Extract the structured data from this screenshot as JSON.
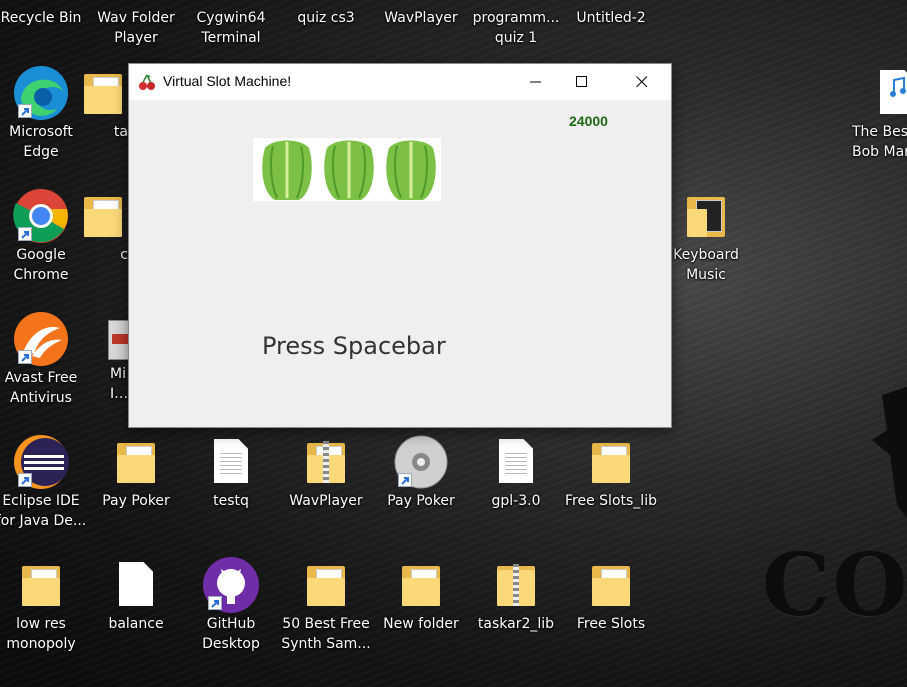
{
  "desktop": {
    "brand_text": "COI",
    "icons": [
      {
        "id": "recycle",
        "label": "Recycle Bin"
      },
      {
        "id": "wavfolder",
        "label": "Wav Folder Player"
      },
      {
        "id": "cygwin",
        "label": "Cygwin64 Terminal"
      },
      {
        "id": "quizcs3",
        "label": "quiz cs3"
      },
      {
        "id": "wavplayer-top",
        "label": "WavPlayer"
      },
      {
        "id": "programm",
        "label": "programm... quiz 1"
      },
      {
        "id": "untitled2",
        "label": "Untitled-2"
      },
      {
        "id": "edge",
        "label": "Microsoft Edge"
      },
      {
        "id": "ta",
        "label": "ta"
      },
      {
        "id": "chrome",
        "label": "Google Chrome"
      },
      {
        "id": "c",
        "label": "c"
      },
      {
        "id": "avast",
        "label": "Avast Free Antivirus"
      },
      {
        "id": "mi",
        "label": "Mi Ins"
      },
      {
        "id": "bestbob",
        "label": "The Best Bob Mar"
      },
      {
        "id": "keyboard",
        "label": "Keyboard Music"
      },
      {
        "id": "eclipse",
        "label": "Eclipse IDE for Java De..."
      },
      {
        "id": "paypoker1",
        "label": "Pay Poker"
      },
      {
        "id": "testq",
        "label": "testq"
      },
      {
        "id": "wavplayer",
        "label": "WavPlayer"
      },
      {
        "id": "paypoker2",
        "label": "Pay Poker"
      },
      {
        "id": "gpl",
        "label": "gpl-3.0"
      },
      {
        "id": "freeslotslib",
        "label": "Free Slots_lib"
      },
      {
        "id": "lowres",
        "label": "low res monopoly"
      },
      {
        "id": "balance",
        "label": "balance"
      },
      {
        "id": "github",
        "label": "GitHub Desktop"
      },
      {
        "id": "synth",
        "label": "50 Best Free Synth Sam..."
      },
      {
        "id": "newfolder",
        "label": "New folder"
      },
      {
        "id": "taskar2",
        "label": "taskar2_lib"
      },
      {
        "id": "freeslots",
        "label": "Free Slots"
      }
    ]
  },
  "window": {
    "title": "Virtual Slot Machine!",
    "score": "24000",
    "reels": [
      "lettuce",
      "lettuce",
      "lettuce"
    ],
    "prompt": "Press Spacebar",
    "controls": {
      "minimize": "minimize-icon",
      "maximize": "maximize-icon",
      "close": "close-icon"
    }
  },
  "colors": {
    "score": "#1c6b13",
    "folder": "#fbd979",
    "titlebar": "#ffffff",
    "client": "#efefef"
  }
}
